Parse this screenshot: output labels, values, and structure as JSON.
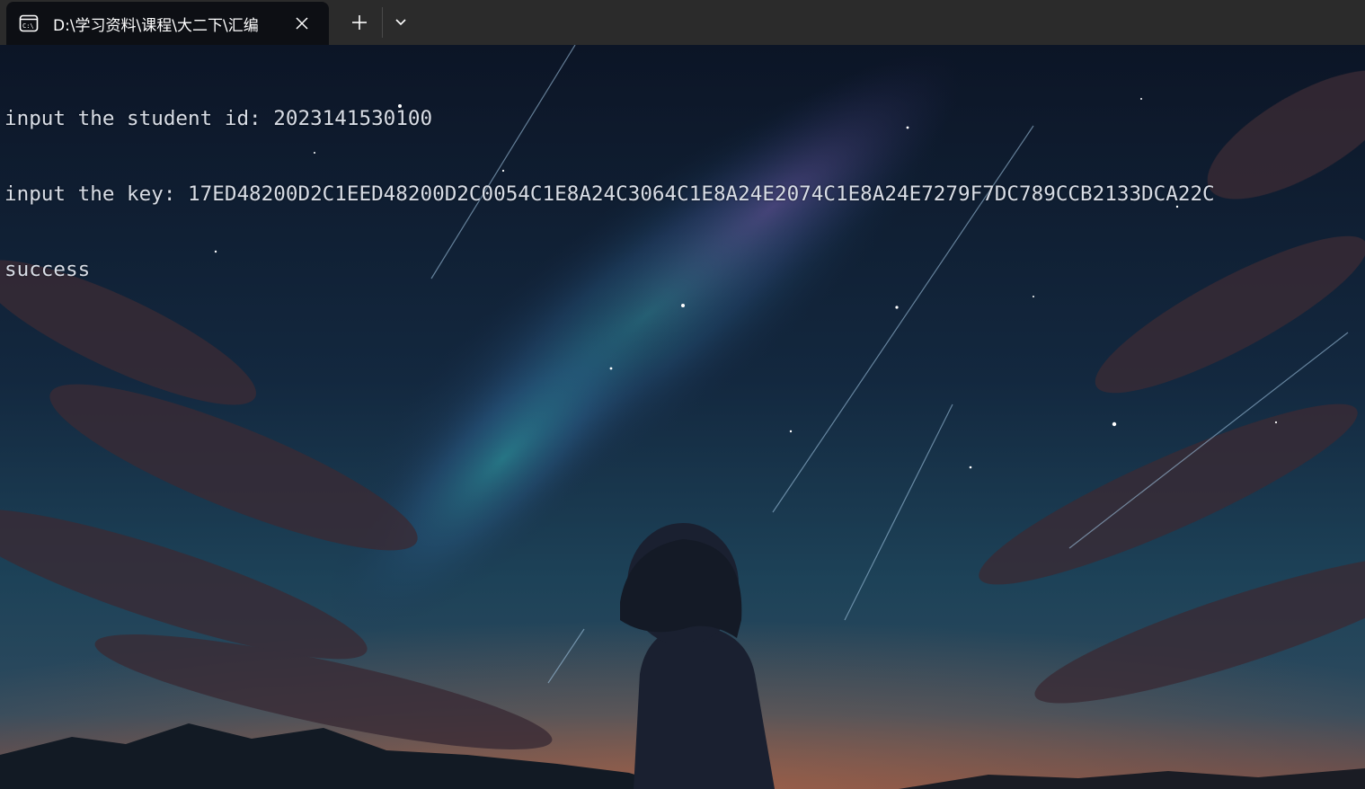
{
  "window": {
    "tab_title": "D:\\学习资料\\课程\\大二下\\汇编",
    "tab_icon": "terminal-icon",
    "close_icon": "close-icon",
    "new_tab_icon": "plus-icon",
    "dropdown_icon": "chevron-down-icon"
  },
  "terminal": {
    "lines": [
      "input the student id: 2023141530100",
      "input the key: 17ED48200D2C1EED48200D2C0054C1E8A24C3064C1E8A24E2074C1E8A24E7279F7DC789CCB2133DCA22C",
      "success"
    ]
  },
  "colors": {
    "tabbar_bg": "#2b2b2b",
    "active_tab_bg": "#0d0f14",
    "text": "#d8dde6"
  }
}
